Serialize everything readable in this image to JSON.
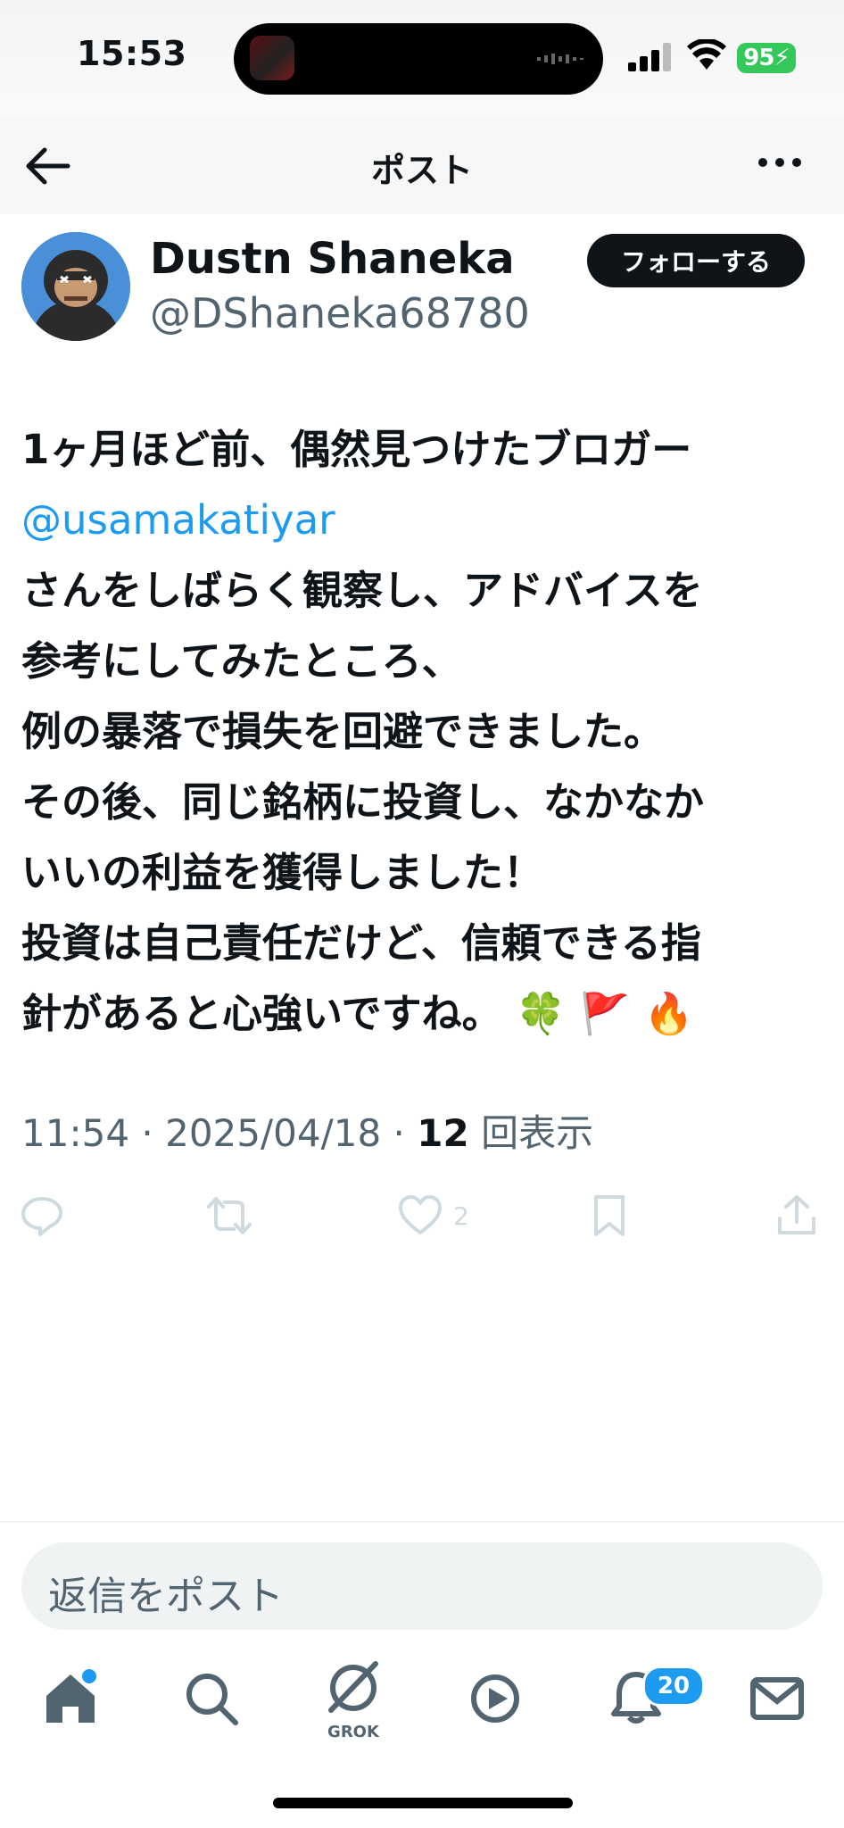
{
  "status_bar": {
    "time": "15:53",
    "battery": "95"
  },
  "header": {
    "title": "ポスト"
  },
  "author": {
    "name": "Dustn Shaneka",
    "handle": "@DShaneka68780",
    "follow_label": "フォローする"
  },
  "post": {
    "lines": [
      "1ヶ月ほど前、偶然見つけたブロガー",
      "@usamakatiyar",
      " さんをしばらく観察し、アドバイスを",
      "参考にしてみたところ、",
      "例の暴落で損失を回避できました。",
      "その後、同じ銘柄に投資し、なかなか",
      "いいの利益を獲得しました！",
      "投資は自己責任だけど、信頼できる指",
      "針があると心強いですね。 🍀 🚩 🔥"
    ],
    "time": "11:54",
    "date": "2025/04/18",
    "views_count": "12",
    "views_label": "回表示"
  },
  "actions": {
    "like_count": "2"
  },
  "reply": {
    "placeholder": "返信をポスト"
  },
  "tabbar": {
    "grok_label": "GROK",
    "notifications_badge": "20"
  },
  "colors": {
    "accent": "#1d9bf0",
    "text": "#0f1419",
    "muted": "#536471",
    "faint": "#cfd9de"
  },
  "icons": [
    "back-arrow-icon",
    "more-icon",
    "reply-icon",
    "repost-icon",
    "like-icon",
    "bookmark-icon",
    "share-icon",
    "home-icon",
    "search-icon",
    "grok-icon",
    "video-icon",
    "notifications-icon",
    "messages-icon"
  ]
}
